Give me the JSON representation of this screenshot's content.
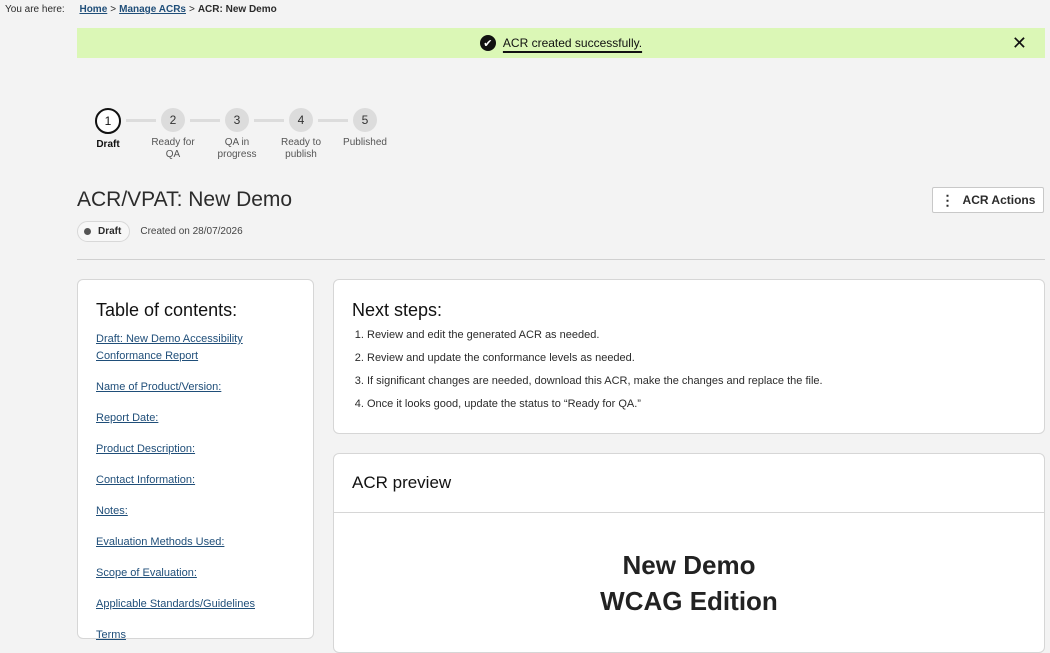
{
  "breadcrumb": {
    "lead": "You are here:",
    "home": "Home",
    "manage": "Manage ACRs",
    "current": "ACR: New Demo"
  },
  "banner": {
    "message": "ACR created successfully."
  },
  "steps": [
    {
      "num": "1",
      "label": "Draft"
    },
    {
      "num": "2",
      "label": "Ready for QA"
    },
    {
      "num": "3",
      "label": "QA in progress"
    },
    {
      "num": "4",
      "label": "Ready to publish"
    },
    {
      "num": "5",
      "label": "Published"
    }
  ],
  "title": "ACR/VPAT: New Demo",
  "actions_label": "ACR Actions",
  "status": "Draft",
  "created": "Created on 28/07/2026",
  "toc": {
    "heading": "Table of contents:",
    "items": [
      "Draft: New Demo Accessibility Conformance Report",
      "Name of Product/Version:",
      "Report Date:",
      "Product Description:",
      "Contact Information:",
      "Notes:",
      "Evaluation Methods Used:",
      "Scope of Evaluation:",
      "Applicable Standards/Guidelines",
      "Terms"
    ]
  },
  "next_steps": {
    "heading": "Next steps:",
    "items": [
      "Review and edit the generated ACR as needed.",
      "Review and update the conformance levels as needed.",
      "If significant changes are needed, download this ACR, make the changes and replace the file.",
      "Once it looks good, update the status to “Ready for QA.”"
    ]
  },
  "preview": {
    "heading": "ACR preview",
    "doc_title_line1": "New Demo",
    "doc_title_line2": "WCAG Edition"
  },
  "colors": {
    "banner_bg": "#dbf7b6",
    "link": "#1f4e79",
    "page_bg": "#f3f3f3"
  }
}
